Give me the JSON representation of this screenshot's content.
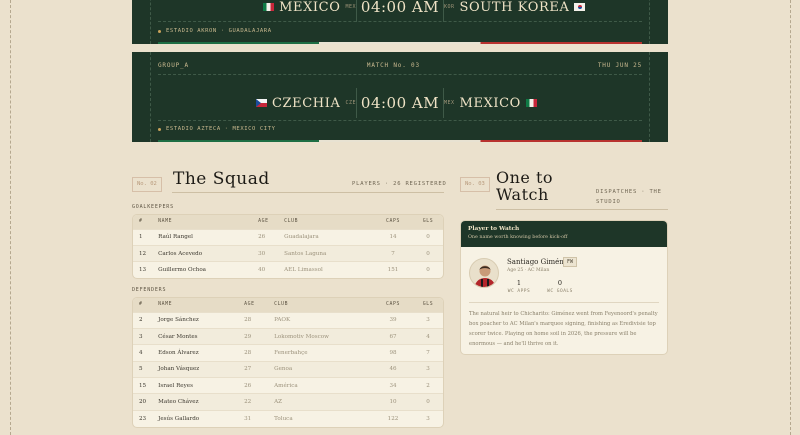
{
  "matches": [
    {
      "home_name": "MEXICO",
      "home_code": "MEX",
      "home_flag": "mx-flag",
      "time": "04:00 AM",
      "away_code": "KOR",
      "away_name": "SOUTH KOREA",
      "away_flag": "kr-flag",
      "venue": "ESTADIO AKRON · GUADALAJARA"
    },
    {
      "group": "GROUP_A",
      "match_no": "MATCH No. 03",
      "date": "THU JUN 25",
      "home_name": "CZECHIA",
      "home_code": "CZE",
      "home_flag": "cz-flag",
      "time": "04:00 AM",
      "away_code": "MEX",
      "away_name": "MEXICO",
      "away_flag": "mx-flag",
      "venue": "ESTADIO AZTECA · MEXICO CITY"
    }
  ],
  "squad": {
    "number": "No. 02",
    "title": "The Squad",
    "meta": "PLAYERS · 26 REGISTERED",
    "goalkeepers": {
      "label": "GOALKEEPERS",
      "headers": {
        "num": "#",
        "name": "NAME",
        "age": "AGE",
        "club": "CLUB",
        "caps": "CAPS",
        "gls": "GLS"
      },
      "rows": [
        {
          "num": "1",
          "name": "Raúl Rangel",
          "age": "26",
          "club": "Guadalajara",
          "caps": "14",
          "gls": "0"
        },
        {
          "num": "12",
          "name": "Carlos Acevedo",
          "age": "30",
          "club": "Santos Laguna",
          "caps": "7",
          "gls": "0"
        },
        {
          "num": "13",
          "name": "Guillermo Ochoa",
          "age": "40",
          "club": "AEL Limassol",
          "caps": "151",
          "gls": "0"
        }
      ]
    },
    "defenders": {
      "label": "DEFENDERS",
      "headers": {
        "num": "#",
        "name": "NAME",
        "age": "AGE",
        "club": "CLUB",
        "caps": "CAPS",
        "gls": "GLS"
      },
      "rows": [
        {
          "num": "2",
          "name": "Jorge Sánchez",
          "age": "28",
          "club": "PAOK",
          "caps": "39",
          "gls": "3"
        },
        {
          "num": "3",
          "name": "César Montes",
          "age": "29",
          "club": "Lokomotiv Moscow",
          "caps": "67",
          "gls": "4"
        },
        {
          "num": "4",
          "name": "Edson Álvarez",
          "age": "28",
          "club": "Fenerbahçe",
          "caps": "98",
          "gls": "7"
        },
        {
          "num": "5",
          "name": "Johan Vásquez",
          "age": "27",
          "club": "Genoa",
          "caps": "46",
          "gls": "3"
        },
        {
          "num": "15",
          "name": "Israel Reyes",
          "age": "26",
          "club": "América",
          "caps": "34",
          "gls": "2"
        },
        {
          "num": "20",
          "name": "Mateo Chávez",
          "age": "22",
          "club": "AZ",
          "caps": "10",
          "gls": "0"
        },
        {
          "num": "23",
          "name": "Jesús Gallardo",
          "age": "31",
          "club": "Toluca",
          "caps": "122",
          "gls": "3"
        }
      ]
    }
  },
  "watch": {
    "number": "No. 03",
    "title": "One to Watch",
    "meta": "DISPATCHES · THE STUDIO",
    "card_heading": "Player to Watch",
    "card_sub": "One name worth knowing before kick-off",
    "player_name": "Santiago Giménez",
    "position": "FW",
    "player_sub": "Age 25 · AC Milan",
    "apps_value": "1",
    "apps_label": "WC APPS",
    "goals_value": "0",
    "goals_label": "WC GOALS",
    "blurb": "The natural heir to Chicharito: Giménez went from Feyenoord's penalty box poacher to AC Milan's marquee signing, finishing as Eredivisie top scorer twice. Playing on home soil in 2026, the pressure will be enormous — and he'll thrive on it."
  },
  "colors": {
    "pitch": "#1e3628",
    "paper": "#ebe1cd",
    "accent": "#c9a35b"
  }
}
